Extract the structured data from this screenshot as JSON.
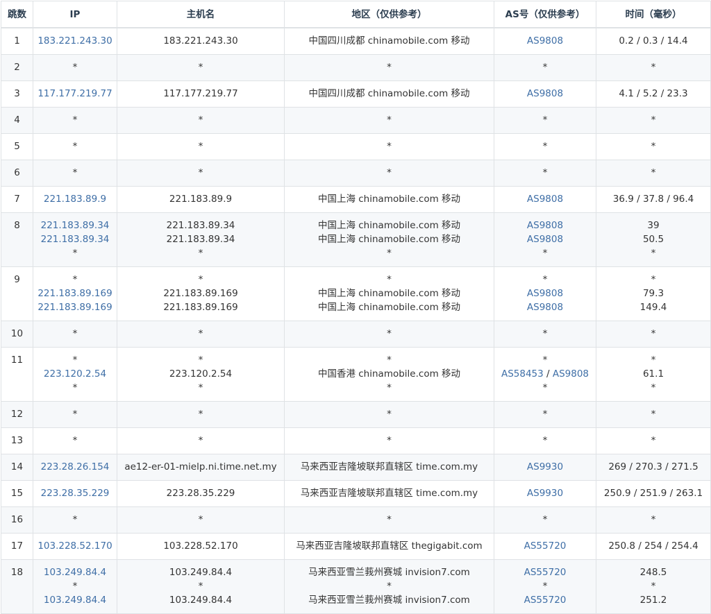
{
  "table": {
    "headers": {
      "hop": "跳数",
      "ip": "IP",
      "host": "主机名",
      "region": "地区（仅供参考）",
      "as": "AS号（仅供参考）",
      "time": "时间（毫秒）"
    },
    "rows": [
      {
        "hop": "1",
        "entries": [
          {
            "ip": "183.221.243.30",
            "host": "183.221.243.30",
            "region": "中国四川成都 chinamobile.com 移动",
            "as": [
              "AS9808"
            ],
            "time": "0.2 / 0.3 / 14.4"
          }
        ]
      },
      {
        "hop": "2",
        "entries": [
          {
            "ip": "*",
            "host": "*",
            "region": "*",
            "as": [
              "*"
            ],
            "time": "*"
          }
        ]
      },
      {
        "hop": "3",
        "entries": [
          {
            "ip": "117.177.219.77",
            "host": "117.177.219.77",
            "region": "中国四川成都 chinamobile.com 移动",
            "as": [
              "AS9808"
            ],
            "time": "4.1 / 5.2 / 23.3"
          }
        ]
      },
      {
        "hop": "4",
        "entries": [
          {
            "ip": "*",
            "host": "*",
            "region": "*",
            "as": [
              "*"
            ],
            "time": "*"
          }
        ]
      },
      {
        "hop": "5",
        "entries": [
          {
            "ip": "*",
            "host": "*",
            "region": "*",
            "as": [
              "*"
            ],
            "time": "*"
          }
        ]
      },
      {
        "hop": "6",
        "entries": [
          {
            "ip": "*",
            "host": "*",
            "region": "*",
            "as": [
              "*"
            ],
            "time": "*"
          }
        ]
      },
      {
        "hop": "7",
        "entries": [
          {
            "ip": "221.183.89.9",
            "host": "221.183.89.9",
            "region": "中国上海 chinamobile.com 移动",
            "as": [
              "AS9808"
            ],
            "time": "36.9 / 37.8 / 96.4"
          }
        ]
      },
      {
        "hop": "8",
        "entries": [
          {
            "ip": "221.183.89.34",
            "host": "221.183.89.34",
            "region": "中国上海 chinamobile.com 移动",
            "as": [
              "AS9808"
            ],
            "time": "39"
          },
          {
            "ip": "221.183.89.34",
            "host": "221.183.89.34",
            "region": "中国上海 chinamobile.com 移动",
            "as": [
              "AS9808"
            ],
            "time": "50.5"
          },
          {
            "ip": "*",
            "host": "*",
            "region": "*",
            "as": [
              "*"
            ],
            "time": "*"
          }
        ]
      },
      {
        "hop": "9",
        "entries": [
          {
            "ip": "*",
            "host": "*",
            "region": "*",
            "as": [
              "*"
            ],
            "time": "*"
          },
          {
            "ip": "221.183.89.169",
            "host": "221.183.89.169",
            "region": "中国上海 chinamobile.com 移动",
            "as": [
              "AS9808"
            ],
            "time": "79.3"
          },
          {
            "ip": "221.183.89.169",
            "host": "221.183.89.169",
            "region": "中国上海 chinamobile.com 移动",
            "as": [
              "AS9808"
            ],
            "time": "149.4"
          }
        ]
      },
      {
        "hop": "10",
        "entries": [
          {
            "ip": "*",
            "host": "*",
            "region": "*",
            "as": [
              "*"
            ],
            "time": "*"
          }
        ]
      },
      {
        "hop": "11",
        "entries": [
          {
            "ip": "*",
            "host": "*",
            "region": "*",
            "as": [
              "*"
            ],
            "time": "*"
          },
          {
            "ip": "223.120.2.54",
            "host": "223.120.2.54",
            "region": "中国香港 chinamobile.com 移动",
            "as": [
              "AS58453",
              "AS9808"
            ],
            "time": "61.1"
          },
          {
            "ip": "*",
            "host": "*",
            "region": "*",
            "as": [
              "*"
            ],
            "time": "*"
          }
        ]
      },
      {
        "hop": "12",
        "entries": [
          {
            "ip": "*",
            "host": "*",
            "region": "*",
            "as": [
              "*"
            ],
            "time": "*"
          }
        ]
      },
      {
        "hop": "13",
        "entries": [
          {
            "ip": "*",
            "host": "*",
            "region": "*",
            "as": [
              "*"
            ],
            "time": "*"
          }
        ]
      },
      {
        "hop": "14",
        "entries": [
          {
            "ip": "223.28.26.154",
            "host": "ae12-er-01-mielp.ni.time.net.my",
            "region": "马来西亚吉隆坡联邦直辖区 time.com.my",
            "as": [
              "AS9930"
            ],
            "time": "269 / 270.3 / 271.5"
          }
        ]
      },
      {
        "hop": "15",
        "entries": [
          {
            "ip": "223.28.35.229",
            "host": "223.28.35.229",
            "region": "马来西亚吉隆坡联邦直辖区 time.com.my",
            "as": [
              "AS9930"
            ],
            "time": "250.9 / 251.9 / 263.1"
          }
        ]
      },
      {
        "hop": "16",
        "entries": [
          {
            "ip": "*",
            "host": "*",
            "region": "*",
            "as": [
              "*"
            ],
            "time": "*"
          }
        ]
      },
      {
        "hop": "17",
        "entries": [
          {
            "ip": "103.228.52.170",
            "host": "103.228.52.170",
            "region": "马来西亚吉隆坡联邦直辖区 thegigabit.com",
            "as": [
              "AS55720"
            ],
            "time": "250.8 / 254 / 254.4"
          }
        ]
      },
      {
        "hop": "18",
        "entries": [
          {
            "ip": "103.249.84.4",
            "host": "103.249.84.4",
            "region": "马来西亚雪兰莪州赛城 invision7.com",
            "as": [
              "AS55720"
            ],
            "time": "248.5"
          },
          {
            "ip": "*",
            "host": "*",
            "region": "*",
            "as": [
              "*"
            ],
            "time": "*"
          },
          {
            "ip": "103.249.84.4",
            "host": "103.249.84.4",
            "region": "马来西亚雪兰莪州赛城 invision7.com",
            "as": [
              "AS55720"
            ],
            "time": "251.2"
          }
        ]
      }
    ]
  },
  "colors": {
    "link": "#3e6ea6",
    "text": "#333333",
    "header_text": "#2c3e50",
    "border": "#dfe2e5",
    "stripe": "#f6f8fa"
  }
}
